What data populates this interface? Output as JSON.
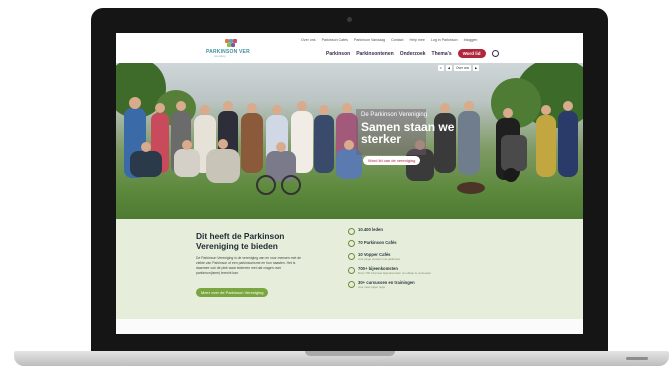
{
  "header": {
    "logo_word": "PARKINSON VER",
    "logo_sub": "vereniging",
    "top_links": [
      "Over ons",
      "Parkinson Cafés",
      "Parkinson Vandaag",
      "Contact",
      "Help mee",
      "Log in Parkinson",
      "Inloggen"
    ],
    "main_nav": [
      "Parkinson",
      "Parkinsontenen",
      "Onderzoek",
      "Thema's"
    ],
    "cta_label": "Word lid"
  },
  "hero": {
    "kicker": "De Parkinson Vereniging",
    "title": "Samen staan we sterker",
    "button_label": "Word lid van de vereniging",
    "controls": [
      "⏸",
      "◀",
      "Over ons",
      "▶"
    ]
  },
  "info": {
    "title": "Dit heeft de Parkinson Vereniging te bieden",
    "text": "De Parkinson Vereniging is de vereniging van en voor mensen met de ziekte van Parkinson of een parkinsonisme en hun naasten. Het is daarmee ook dé plek waar iedereen met dat vragen over parkinson(isme) terecht kan.",
    "button_label": "Meer over de Parkinson Vereniging",
    "stats": [
      {
        "label": "10.400 leden",
        "sub": ""
      },
      {
        "label": "70 Parkinson Cafés",
        "sub": ""
      },
      {
        "label": "10 Vopper Cafés",
        "sub": "voor jonge mensen met parkinson"
      },
      {
        "label": "700+ bijeenkomsten",
        "sub": "Ruim 700 informele bijeenkomsten om elkaar te ontmoeten"
      },
      {
        "label": "30+ cursussen en trainingen",
        "sub": "voor meer eigen regie"
      }
    ]
  },
  "colors": {
    "brand_red": "#b0263a",
    "brand_green": "#7aa63f",
    "section_bg": "#e6eedb"
  }
}
